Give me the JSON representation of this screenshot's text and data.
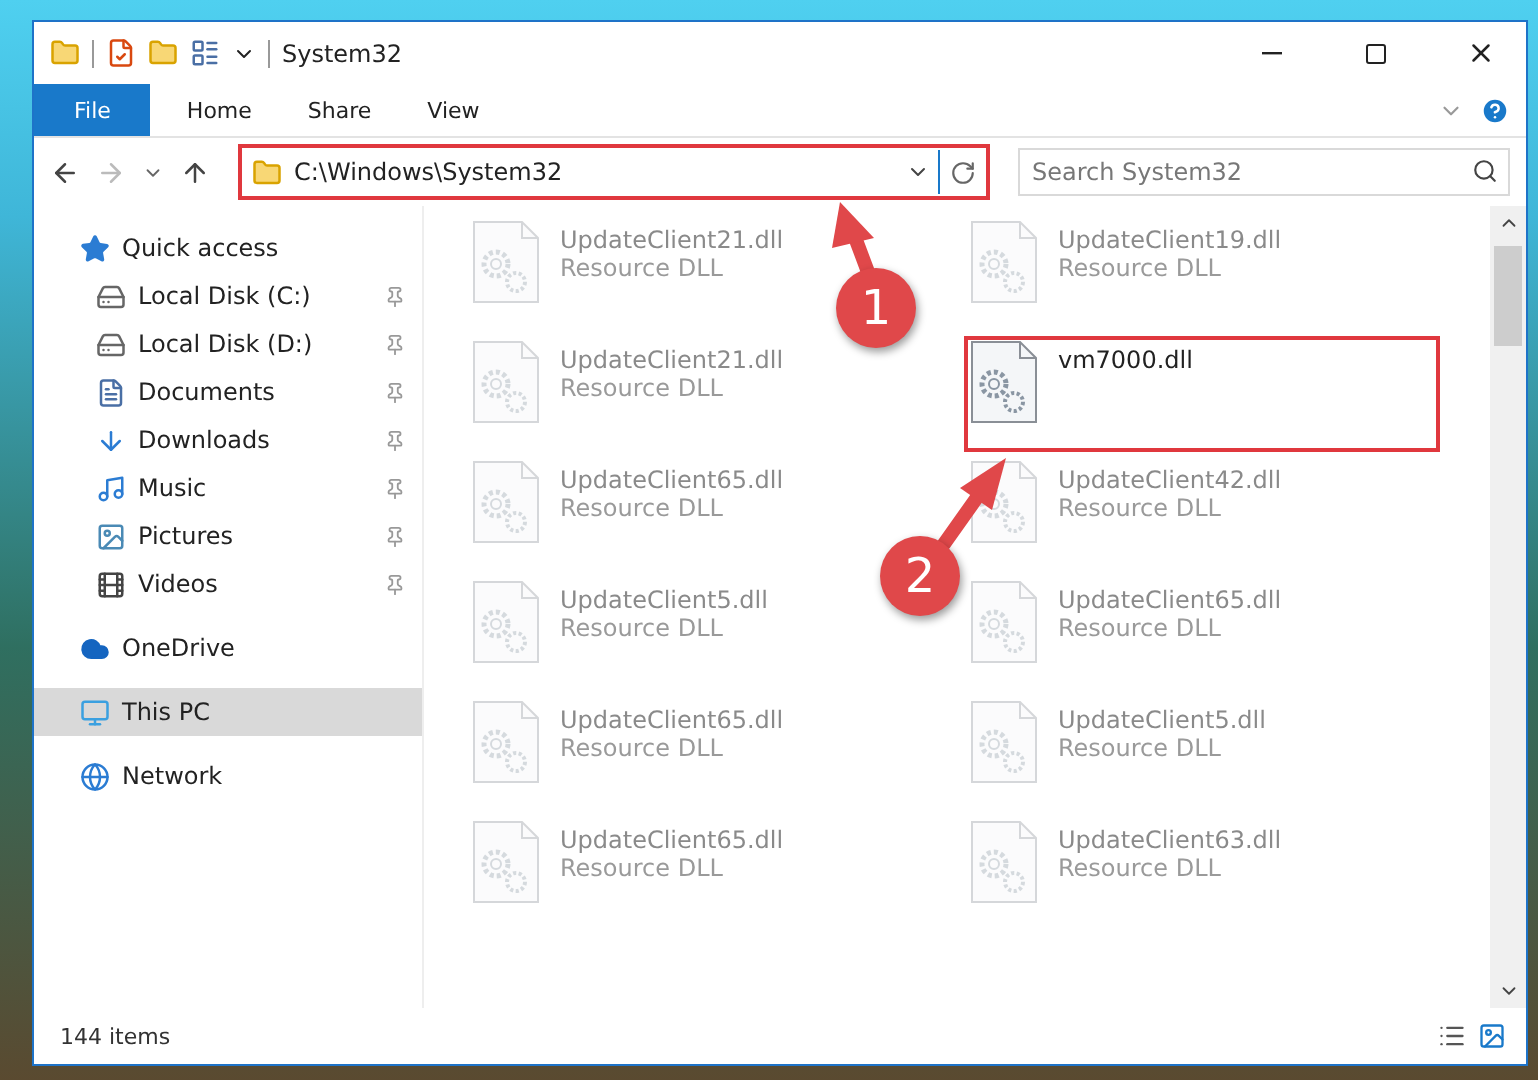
{
  "window": {
    "title": "System32"
  },
  "ribbon_tabs": [
    {
      "label": "File",
      "kind": "file"
    },
    {
      "label": "Home",
      "kind": "tab"
    },
    {
      "label": "Share",
      "kind": "tab"
    },
    {
      "label": "View",
      "kind": "tab"
    }
  ],
  "address": {
    "path": "C:\\Windows\\System32",
    "highlighted": true
  },
  "search": {
    "placeholder": "Search System32"
  },
  "sidebar": {
    "items": [
      {
        "label": "Quick access",
        "kind": "star",
        "selected": false,
        "children": [
          {
            "label": "Local Disk (C:)",
            "kind": "disk",
            "pinned": true,
            "selected": false
          },
          {
            "label": "Local Disk (D:)",
            "kind": "disk",
            "pinned": true,
            "selected": false
          },
          {
            "label": "Documents",
            "kind": "docs",
            "pinned": true,
            "selected": false
          },
          {
            "label": "Downloads",
            "kind": "download",
            "pinned": true,
            "selected": false
          },
          {
            "label": "Music",
            "kind": "music",
            "pinned": true,
            "selected": false
          },
          {
            "label": "Pictures",
            "kind": "pictures",
            "pinned": true,
            "selected": false
          },
          {
            "label": "Videos",
            "kind": "videos",
            "pinned": true,
            "selected": false
          }
        ]
      },
      {
        "label": "OneDrive",
        "kind": "cloud",
        "selected": false
      },
      {
        "label": "This PC",
        "kind": "pc",
        "selected": true
      },
      {
        "label": "Network",
        "kind": "network",
        "selected": false
      }
    ]
  },
  "files": [
    {
      "name": "UpdateClient21.dll",
      "type": "Resource DLL",
      "dimmed": true,
      "highlighted": false
    },
    {
      "name": "UpdateClient19.dll",
      "type": "Resource DLL",
      "dimmed": true,
      "highlighted": false
    },
    {
      "name": "UpdateClient21.dll",
      "type": "Resource DLL",
      "dimmed": true,
      "highlighted": false
    },
    {
      "name": "vm7000.dll",
      "dimmed": false,
      "highlighted": true
    },
    {
      "name": "UpdateClient65.dll",
      "type": "Resource DLL",
      "dimmed": true,
      "highlighted": false
    },
    {
      "name": "UpdateClient42.dll",
      "type": "Resource DLL",
      "dimmed": true,
      "highlighted": false
    },
    {
      "name": "UpdateClient5.dll",
      "type": "Resource DLL",
      "dimmed": true,
      "highlighted": false
    },
    {
      "name": "UpdateClient65.dll",
      "type": "Resource DLL",
      "dimmed": true,
      "highlighted": false
    },
    {
      "name": "UpdateClient65.dll",
      "type": "Resource DLL",
      "dimmed": true,
      "highlighted": false
    },
    {
      "name": "UpdateClient5.dll",
      "type": "Resource DLL",
      "dimmed": true,
      "highlighted": false
    },
    {
      "name": "UpdateClient65.dll",
      "type": "Resource DLL",
      "dimmed": true,
      "highlighted": false
    },
    {
      "name": "UpdateClient63.dll",
      "type": "Resource DLL",
      "dimmed": true,
      "highlighted": false
    }
  ],
  "status_bar": {
    "count": "144 items"
  },
  "annotations": [
    {
      "number": "1"
    },
    {
      "number": "2"
    }
  ]
}
